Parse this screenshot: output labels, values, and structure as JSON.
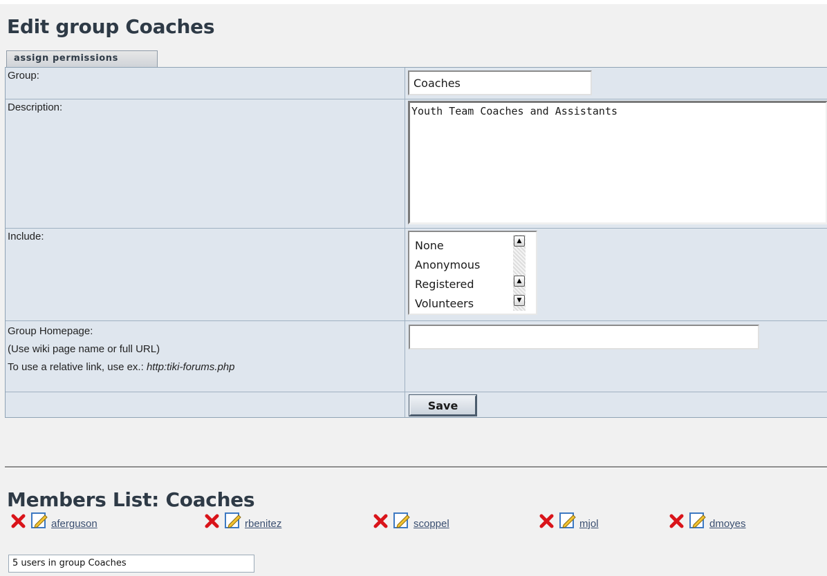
{
  "page": {
    "title": "Edit group Coaches",
    "tab_label": "assign permissions"
  },
  "form": {
    "group_label": "Group:",
    "group_value": "Coaches",
    "description_label": "Description:",
    "description_value": "Youth Team Coaches and Assistants",
    "include_label": "Include:",
    "include_options": [
      "None",
      "Anonymous",
      "Registered",
      "Volunteers"
    ],
    "homepage_label_line1": "Group Homepage:",
    "homepage_label_line2": "(Use wiki page name or full URL)",
    "homepage_label_line3_prefix": "To use a relative link, use ex.: ",
    "homepage_label_line3_example": "http:tiki-forums.php",
    "homepage_value": "",
    "save_label": "Save"
  },
  "members": {
    "title": "Members List: Coaches",
    "users": [
      "aferguson",
      "rbenitez",
      "scoppel",
      "mjol",
      "dmoyes"
    ],
    "count_text": "5 users in group Coaches"
  },
  "icons": {
    "delete": "delete-x-icon",
    "edit": "edit-pencil-icon"
  },
  "colors": {
    "title": "#2e3a46",
    "table_bg": "#dfe6ee",
    "delete_red": "#d9141a",
    "link": "#3a4e70"
  }
}
